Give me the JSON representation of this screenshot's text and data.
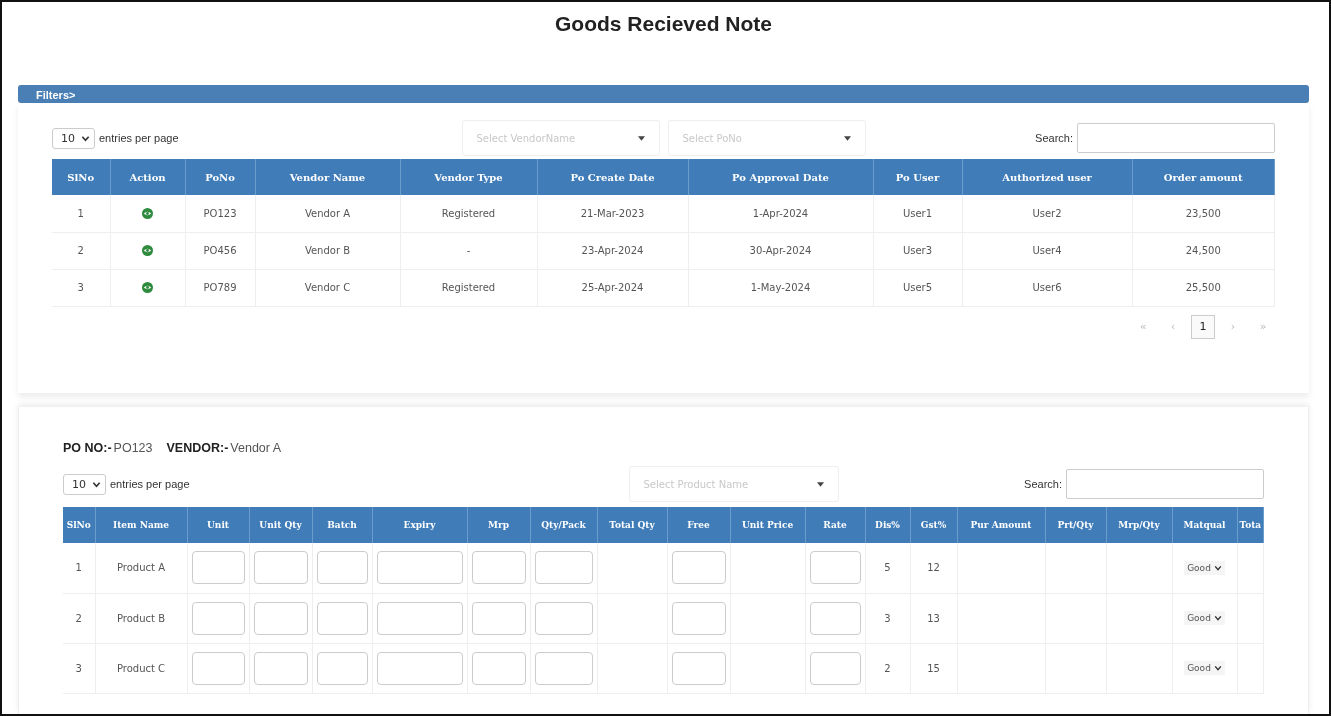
{
  "title": "Goods Recieved Note",
  "filter_bar": {
    "label": "Filters>"
  },
  "po_list": {
    "entries": {
      "value": "10",
      "label": "entries per page"
    },
    "dropdowns": [
      {
        "placeholder": "Select VendorName"
      },
      {
        "placeholder": "Select PoNo"
      }
    ],
    "search": {
      "label": "Search:"
    },
    "columns": [
      {
        "label": "SlNo",
        "kind": "text"
      },
      {
        "label": "Action",
        "kind": "action"
      },
      {
        "label": "PoNo",
        "kind": "text"
      },
      {
        "label": "Vendor Name",
        "kind": "text"
      },
      {
        "label": "Vendor Type",
        "kind": "text"
      },
      {
        "label": "Po Create Date",
        "kind": "text"
      },
      {
        "label": "Po Approval Date",
        "kind": "text"
      },
      {
        "label": "Po User",
        "kind": "text"
      },
      {
        "label": "Authorized user",
        "kind": "text"
      },
      {
        "label": "Order amount",
        "kind": "text"
      }
    ],
    "rows": [
      [
        "1",
        "",
        "PO123",
        "Vendor A",
        "Registered",
        "21-Mar-2023",
        "1-Apr-2024",
        "User1",
        "User2",
        "23,500"
      ],
      [
        "2",
        "",
        "PO456",
        "Vendor B",
        "-",
        "23-Apr-2024",
        "30-Apr-2024",
        "User3",
        "User4",
        "24,500"
      ],
      [
        "3",
        "",
        "PO789",
        "Vendor C",
        "Registered",
        "25-Apr-2024",
        "1-May-2024",
        "User5",
        "User6",
        "25,500"
      ]
    ],
    "pagination": [
      {
        "label": "«",
        "selected": false,
        "disabled": true
      },
      {
        "label": "‹",
        "selected": false,
        "disabled": true
      },
      {
        "label": "1",
        "selected": true,
        "disabled": false
      },
      {
        "label": "›",
        "selected": false,
        "disabled": true
      },
      {
        "label": "»",
        "selected": false,
        "disabled": true
      }
    ]
  },
  "po_detail": {
    "info": [
      {
        "label": "PO NO:-",
        "value": "PO123"
      },
      {
        "label": "VENDOR:-",
        "value": "Vendor A"
      }
    ],
    "entries": {
      "value": "10",
      "label": "entries per page"
    },
    "dropdown": {
      "placeholder": "Select Product Name"
    },
    "search": {
      "label": "Search:"
    },
    "columns": [
      {
        "label": "SlNo",
        "kind": "text"
      },
      {
        "label": "Item Name",
        "kind": "text"
      },
      {
        "label": "Unit",
        "kind": "input"
      },
      {
        "label": "Unit Qty",
        "kind": "input"
      },
      {
        "label": "Batch",
        "kind": "input"
      },
      {
        "label": "Expiry",
        "kind": "input"
      },
      {
        "label": "Mrp",
        "kind": "input"
      },
      {
        "label": "Qty/Pack",
        "kind": "input"
      },
      {
        "label": "Total Qty",
        "kind": "blank"
      },
      {
        "label": "Free",
        "kind": "input"
      },
      {
        "label": "Unit Price",
        "kind": "blank"
      },
      {
        "label": "Rate",
        "kind": "input"
      },
      {
        "label": "Dis%",
        "kind": "text"
      },
      {
        "label": "Gst%",
        "kind": "text"
      },
      {
        "label": "Pur Amount",
        "kind": "blank"
      },
      {
        "label": "Prt/Qty",
        "kind": "blank"
      },
      {
        "label": "Mrp/Qty",
        "kind": "blank"
      },
      {
        "label": "Matqual",
        "kind": "select"
      },
      {
        "label": "Tota",
        "kind": "blank"
      }
    ],
    "rows": [
      {
        "values": [
          "1",
          "Product A",
          "5",
          "12",
          "Good"
        ]
      },
      {
        "values": [
          "2",
          "Product B",
          "3",
          "13",
          "Good"
        ]
      },
      {
        "values": [
          "3",
          "Product C",
          "2",
          "15",
          "Good"
        ]
      }
    ]
  }
}
